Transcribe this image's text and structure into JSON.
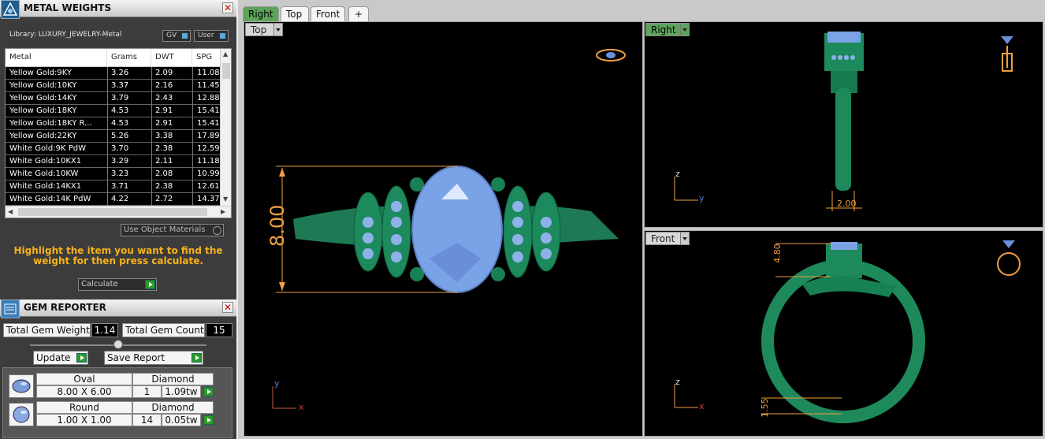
{
  "metal_panel": {
    "title": "METAL WEIGHTS",
    "library_label": "Library: LUXURY_JEWELRY-Metal",
    "toggle_gv": "GV",
    "toggle_user": "User",
    "columns": [
      "Metal",
      "Grams",
      "DWT",
      "SPG"
    ],
    "rows": [
      [
        "Yellow Gold:9KY",
        "3.26",
        "2.09",
        "11.08"
      ],
      [
        "Yellow Gold:10KY",
        "3.37",
        "2.16",
        "11.45"
      ],
      [
        "Yellow Gold:14KY",
        "3.79",
        "2.43",
        "12.88"
      ],
      [
        "Yellow Gold:18KY",
        "4.53",
        "2.91",
        "15.41"
      ],
      [
        "Yellow Gold:18KY R...",
        "4.53",
        "2.91",
        "15.41"
      ],
      [
        "Yellow Gold:22KY",
        "5.26",
        "3.38",
        "17.89"
      ],
      [
        "White Gold:9K PdW",
        "3.70",
        "2.38",
        "12.59"
      ],
      [
        "White Gold:10KX1",
        "3.29",
        "2.11",
        "11.18"
      ],
      [
        "White Gold:10KW",
        "3.23",
        "2.08",
        "10.99"
      ],
      [
        "White Gold:14KX1",
        "3.71",
        "2.38",
        "12.61"
      ],
      [
        "White Gold:14K PdW",
        "4.22",
        "2.72",
        "14.37"
      ]
    ],
    "use_object_materials": "Use Object Materials",
    "hint": "Highlight the item you want to find the weight for then press calculate.",
    "calculate_label": "Calculate"
  },
  "gem_panel": {
    "title": "GEM REPORTER",
    "total_weight_label": "Total Gem Weight",
    "total_weight_value": "1.14",
    "total_count_label": "Total Gem Count",
    "total_count_value": "15",
    "update_label": "Update",
    "save_report_label": "Save Report",
    "gems": [
      {
        "shape": "Oval",
        "size": "8.00 X 6.00",
        "material": "Diamond",
        "count": "1",
        "weight": "1.09tw"
      },
      {
        "shape": "Round",
        "size": "1.00 X 1.00",
        "material": "Diamond",
        "count": "14",
        "weight": "0.05tw"
      }
    ]
  },
  "tabs": [
    "Right",
    "Top",
    "Front",
    "+"
  ],
  "viewports": {
    "top": {
      "label": "Top",
      "dimension": "8.00",
      "axis_y": "y",
      "axis_x": "x"
    },
    "right": {
      "label": "Right",
      "dimension": "2.00",
      "axis_z": "z",
      "axis_y": "y"
    },
    "front": {
      "label": "Front",
      "dimension_top": "4.80",
      "dimension_bottom": "1.55",
      "axis_z": "z",
      "axis_x": "x"
    }
  },
  "colors": {
    "accent_green": "#5da45b",
    "ring_green": "#1e8a5c",
    "gem_blue": "#7aa2e6",
    "dimension_orange": "#f0a040",
    "hint_orange": "#f7b21b"
  }
}
